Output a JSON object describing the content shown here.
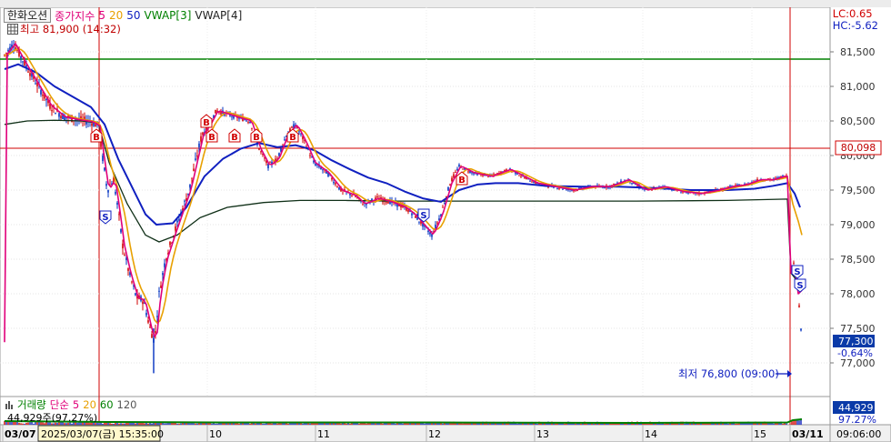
{
  "legend": {
    "stock_name": "한화오션",
    "ma_label": "종가지수",
    "ma_periods": [
      "5",
      "20",
      "50"
    ],
    "vwap3": "VWAP[3]",
    "vwap4": "VWAP[4]",
    "high_label": "최고 81,900 (14:32)"
  },
  "right_info": {
    "lc": "LC:0.65",
    "hc": "HC:-5.62"
  },
  "price_axis": {
    "ticks": [
      "81,500",
      "81,000",
      "80,500",
      "80,000",
      "79,500",
      "79,000",
      "78,500",
      "78,000",
      "77,500",
      "77,000"
    ],
    "ref_label": "80,098",
    "current_label": "77,300",
    "current_change": "-0.64%"
  },
  "low_annotation": "최저 76,800 (09:00)",
  "volume": {
    "label": "거래량",
    "ma_label": "단순",
    "ma_periods": [
      "5",
      "20",
      "60",
      "120"
    ],
    "value_text": "44,929주(97.27%)",
    "axis_value": "44,929",
    "axis_pct": "97.27%"
  },
  "time_axis": {
    "labels": [
      "03/07",
      "10",
      "11",
      "12",
      "13",
      "14",
      "15",
      "03/11"
    ],
    "tooltip": "2025/03/07(금) 15:35:00",
    "time_readout": "09:06:00"
  },
  "markers": {
    "buy": "B",
    "sell": "S"
  },
  "colors": {
    "ma5": "#e0007a",
    "ma20": "#e8a000",
    "ma50": "#1020c0",
    "vwap": "#103018",
    "green_line": "#008000",
    "red_line": "#d00000",
    "candle_up": "#d00000",
    "candle_down": "#0030c0"
  }
}
